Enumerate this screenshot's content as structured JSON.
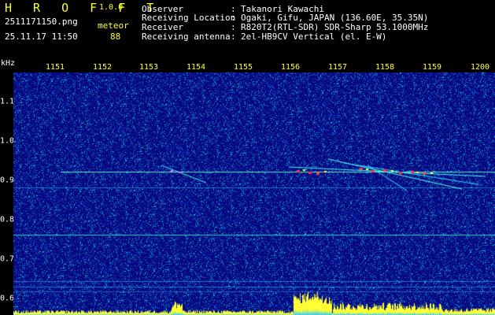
{
  "header": {
    "app_name": "H R O F F T",
    "version": "1.0.0",
    "filename": "2511171150.png",
    "mode": "meteor",
    "datetime": "25.11.17 11:50",
    "count": "88",
    "fields": [
      {
        "label": "Observer",
        "value": "Takanori Kawachi"
      },
      {
        "label": "Receiving Location",
        "value": "Ogaki, Gifu, JAPAN (136.60E, 35.35N)"
      },
      {
        "label": "Receiver",
        "value": "R820T2(RTL-SDR) SDR-Sharp 53.1000MHz"
      },
      {
        "label": "Receiving antenna",
        "value": "2el-HB9CV Vertical (el. E-W)"
      }
    ],
    "separator": ":"
  },
  "axes": {
    "y_unit": "kHz",
    "x_ticks": [
      "1151",
      "1152",
      "1153",
      "1154",
      "1155",
      "1156",
      "1157",
      "1158",
      "1159",
      "1200"
    ],
    "y_ticks": [
      "1.1",
      "1.0",
      "0.9",
      "0.8",
      "0.7",
      "0.6"
    ]
  },
  "colors": {
    "background": "#000000",
    "label_yellow": "#ffff33",
    "label_white": "#ffffff",
    "spectrogram_base": "#0a0a8a",
    "signal_cyan": "#33ffff",
    "signal_red": "#ff3333"
  }
}
